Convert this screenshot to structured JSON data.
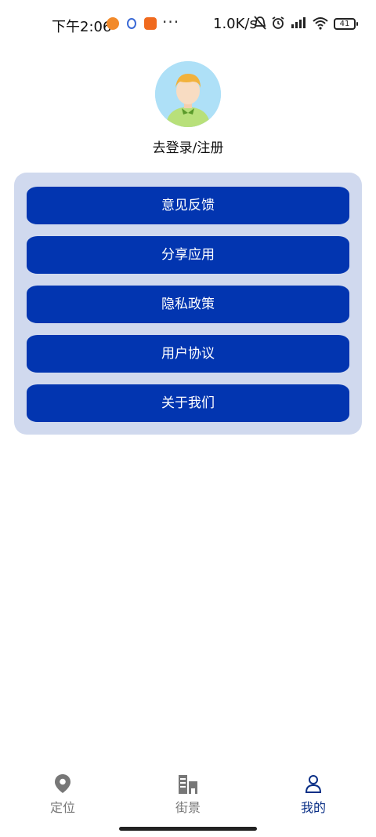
{
  "status_bar": {
    "time": "下午2:06",
    "more": "···",
    "speed": "1.0K/s",
    "battery": "41"
  },
  "profile": {
    "login_label": "去登录/注册"
  },
  "menu": {
    "items": [
      {
        "label": "意见反馈"
      },
      {
        "label": "分享应用"
      },
      {
        "label": "隐私政策"
      },
      {
        "label": "用户协议"
      },
      {
        "label": "关于我们"
      }
    ]
  },
  "nav": {
    "items": [
      {
        "label": "定位",
        "icon": "location-pin-icon"
      },
      {
        "label": "街景",
        "icon": "buildings-icon"
      },
      {
        "label": "我的",
        "icon": "person-icon",
        "active": true
      }
    ]
  },
  "colors": {
    "button": "#0235b0",
    "card": "#d0d9ee",
    "active_nav": "#0a2f86",
    "inactive_nav": "#777777"
  }
}
